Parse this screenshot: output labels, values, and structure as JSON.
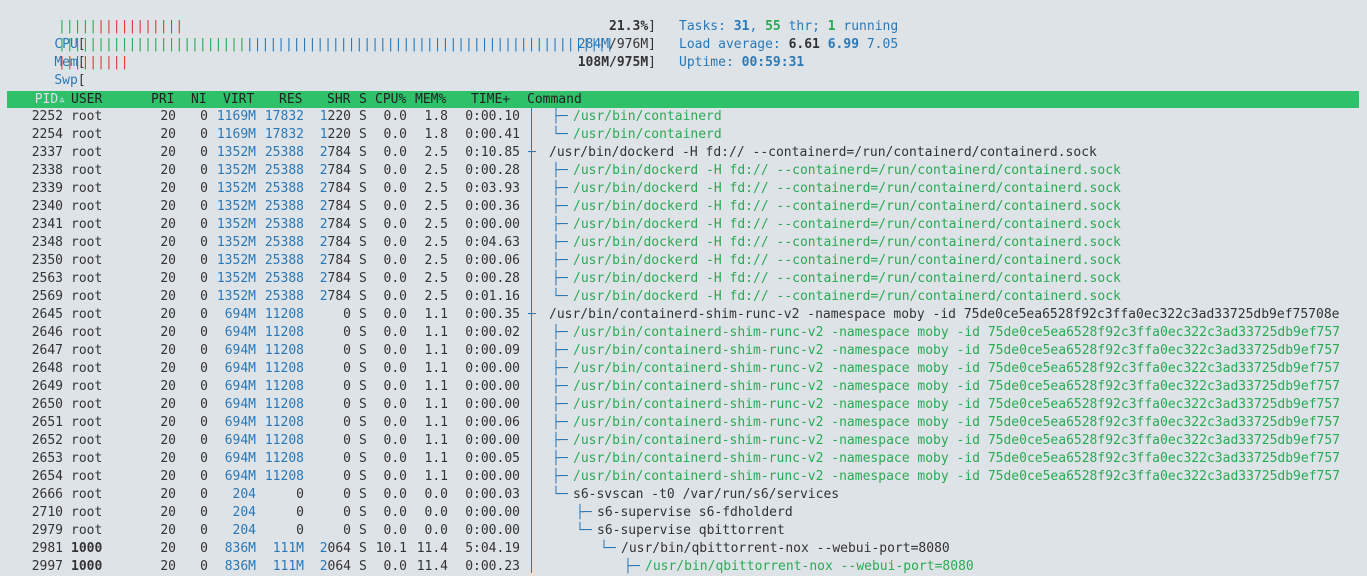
{
  "meters": {
    "cpu": {
      "label": "CPU",
      "green_bars": "|||||",
      "red_bars": "|||||||||||",
      "value": "21.3%"
    },
    "mem": {
      "label": "Mem",
      "green_bars": "||||||||||||||||||||||||",
      "blue_bars": "|||||||||||||||||||||||||||||||||||||||||||||||",
      "value_used": "284M",
      "value_total": "976M"
    },
    "swp": {
      "label": "Swp",
      "red_bars": "|||||||||",
      "value": "108M/975M"
    }
  },
  "info": {
    "tasks_label": "Tasks:",
    "tasks": "31",
    "threads": "55",
    "threads_suffix": "thr;",
    "running": "1",
    "running_suffix": "running",
    "load_label": "Load average:",
    "load1": "6.61",
    "load5": "6.99",
    "load15": "7.05",
    "uptime_label": "Uptime:",
    "uptime": "00:59:31"
  },
  "columns": {
    "pid": "PID",
    "sort_arrow": "▵",
    "user": "USER",
    "pri": "PRI",
    "ni": "NI",
    "virt": "VIRT",
    "res": "RES",
    "shr": "SHR",
    "s": "S",
    "cpu": "CPU%",
    "mem": "MEM%",
    "time": "TIME+",
    "command": "Command"
  },
  "processes": [
    {
      "pid": "2252",
      "user": "root",
      "pri": "20",
      "ni": "0",
      "virt": "1169M",
      "res_k": "17832",
      "res": "",
      "shr_k": "1",
      "shr": "220",
      "s": "S",
      "cpu": "0.0",
      "mem": "1.8",
      "time": "0:00.10",
      "tree": "├─ ",
      "indent": 2,
      "cmd": "/usr/bin/containerd",
      "thread": true
    },
    {
      "pid": "2254",
      "user": "root",
      "pri": "20",
      "ni": "0",
      "virt": "1169M",
      "res_k": "17832",
      "res": "",
      "shr_k": "1",
      "shr": "220",
      "s": "S",
      "cpu": "0.0",
      "mem": "1.8",
      "time": "0:00.41",
      "tree": "└─ ",
      "indent": 2,
      "cmd": "/usr/bin/containerd",
      "thread": true
    },
    {
      "pid": "2337",
      "user": "root",
      "pri": "20",
      "ni": "0",
      "virt": "1352M",
      "res_k": "25388",
      "res": "",
      "shr_k": "2",
      "shr": "784",
      "s": "S",
      "cpu": "0.0",
      "mem": "2.5",
      "time": "0:10.85",
      "tree": "├─ ",
      "indent": 1,
      "cmd": "/usr/bin/dockerd -H fd:// --containerd=/run/containerd/containerd.sock",
      "thread": false
    },
    {
      "pid": "2338",
      "user": "root",
      "pri": "20",
      "ni": "0",
      "virt": "1352M",
      "res_k": "25388",
      "res": "",
      "shr_k": "2",
      "shr": "784",
      "s": "S",
      "cpu": "0.0",
      "mem": "2.5",
      "time": "0:00.28",
      "tree": "├─ ",
      "indent": 2,
      "cmd": "/usr/bin/dockerd -H fd:// --containerd=/run/containerd/containerd.sock",
      "thread": true
    },
    {
      "pid": "2339",
      "user": "root",
      "pri": "20",
      "ni": "0",
      "virt": "1352M",
      "res_k": "25388",
      "res": "",
      "shr_k": "2",
      "shr": "784",
      "s": "S",
      "cpu": "0.0",
      "mem": "2.5",
      "time": "0:03.93",
      "tree": "├─ ",
      "indent": 2,
      "cmd": "/usr/bin/dockerd -H fd:// --containerd=/run/containerd/containerd.sock",
      "thread": true
    },
    {
      "pid": "2340",
      "user": "root",
      "pri": "20",
      "ni": "0",
      "virt": "1352M",
      "res_k": "25388",
      "res": "",
      "shr_k": "2",
      "shr": "784",
      "s": "S",
      "cpu": "0.0",
      "mem": "2.5",
      "time": "0:00.36",
      "tree": "├─ ",
      "indent": 2,
      "cmd": "/usr/bin/dockerd -H fd:// --containerd=/run/containerd/containerd.sock",
      "thread": true
    },
    {
      "pid": "2341",
      "user": "root",
      "pri": "20",
      "ni": "0",
      "virt": "1352M",
      "res_k": "25388",
      "res": "",
      "shr_k": "2",
      "shr": "784",
      "s": "S",
      "cpu": "0.0",
      "mem": "2.5",
      "time": "0:00.00",
      "tree": "├─ ",
      "indent": 2,
      "cmd": "/usr/bin/dockerd -H fd:// --containerd=/run/containerd/containerd.sock",
      "thread": true
    },
    {
      "pid": "2348",
      "user": "root",
      "pri": "20",
      "ni": "0",
      "virt": "1352M",
      "res_k": "25388",
      "res": "",
      "shr_k": "2",
      "shr": "784",
      "s": "S",
      "cpu": "0.0",
      "mem": "2.5",
      "time": "0:04.63",
      "tree": "├─ ",
      "indent": 2,
      "cmd": "/usr/bin/dockerd -H fd:// --containerd=/run/containerd/containerd.sock",
      "thread": true
    },
    {
      "pid": "2350",
      "user": "root",
      "pri": "20",
      "ni": "0",
      "virt": "1352M",
      "res_k": "25388",
      "res": "",
      "shr_k": "2",
      "shr": "784",
      "s": "S",
      "cpu": "0.0",
      "mem": "2.5",
      "time": "0:00.06",
      "tree": "├─ ",
      "indent": 2,
      "cmd": "/usr/bin/dockerd -H fd:// --containerd=/run/containerd/containerd.sock",
      "thread": true
    },
    {
      "pid": "2563",
      "user": "root",
      "pri": "20",
      "ni": "0",
      "virt": "1352M",
      "res_k": "25388",
      "res": "",
      "shr_k": "2",
      "shr": "784",
      "s": "S",
      "cpu": "0.0",
      "mem": "2.5",
      "time": "0:00.28",
      "tree": "├─ ",
      "indent": 2,
      "cmd": "/usr/bin/dockerd -H fd:// --containerd=/run/containerd/containerd.sock",
      "thread": true
    },
    {
      "pid": "2569",
      "user": "root",
      "pri": "20",
      "ni": "0",
      "virt": "1352M",
      "res_k": "25388",
      "res": "",
      "shr_k": "2",
      "shr": "784",
      "s": "S",
      "cpu": "0.0",
      "mem": "2.5",
      "time": "0:01.16",
      "tree": "└─ ",
      "indent": 2,
      "cmd": "/usr/bin/dockerd -H fd:// --containerd=/run/containerd/containerd.sock",
      "thread": true
    },
    {
      "pid": "2645",
      "user": "root",
      "pri": "20",
      "ni": "0",
      "virt": "694M",
      "res_k": "11208",
      "res": "",
      "shr_k": "",
      "shr": "0",
      "s": "S",
      "cpu": "0.0",
      "mem": "1.1",
      "time": "0:00.35",
      "tree": "├─ ",
      "indent": 1,
      "cmd": "/usr/bin/containerd-shim-runc-v2 -namespace moby -id 75de0ce5ea6528f92c3ffa0ec322c3ad33725db9ef75708e",
      "thread": false
    },
    {
      "pid": "2646",
      "user": "root",
      "pri": "20",
      "ni": "0",
      "virt": "694M",
      "res_k": "11208",
      "res": "",
      "shr_k": "",
      "shr": "0",
      "s": "S",
      "cpu": "0.0",
      "mem": "1.1",
      "time": "0:00.02",
      "tree": "├─ ",
      "indent": 2,
      "cmd": "/usr/bin/containerd-shim-runc-v2 -namespace moby -id 75de0ce5ea6528f92c3ffa0ec322c3ad33725db9ef757",
      "thread": true
    },
    {
      "pid": "2647",
      "user": "root",
      "pri": "20",
      "ni": "0",
      "virt": "694M",
      "res_k": "11208",
      "res": "",
      "shr_k": "",
      "shr": "0",
      "s": "S",
      "cpu": "0.0",
      "mem": "1.1",
      "time": "0:00.09",
      "tree": "├─ ",
      "indent": 2,
      "cmd": "/usr/bin/containerd-shim-runc-v2 -namespace moby -id 75de0ce5ea6528f92c3ffa0ec322c3ad33725db9ef757",
      "thread": true
    },
    {
      "pid": "2648",
      "user": "root",
      "pri": "20",
      "ni": "0",
      "virt": "694M",
      "res_k": "11208",
      "res": "",
      "shr_k": "",
      "shr": "0",
      "s": "S",
      "cpu": "0.0",
      "mem": "1.1",
      "time": "0:00.00",
      "tree": "├─ ",
      "indent": 2,
      "cmd": "/usr/bin/containerd-shim-runc-v2 -namespace moby -id 75de0ce5ea6528f92c3ffa0ec322c3ad33725db9ef757",
      "thread": true
    },
    {
      "pid": "2649",
      "user": "root",
      "pri": "20",
      "ni": "0",
      "virt": "694M",
      "res_k": "11208",
      "res": "",
      "shr_k": "",
      "shr": "0",
      "s": "S",
      "cpu": "0.0",
      "mem": "1.1",
      "time": "0:00.00",
      "tree": "├─ ",
      "indent": 2,
      "cmd": "/usr/bin/containerd-shim-runc-v2 -namespace moby -id 75de0ce5ea6528f92c3ffa0ec322c3ad33725db9ef757",
      "thread": true
    },
    {
      "pid": "2650",
      "user": "root",
      "pri": "20",
      "ni": "0",
      "virt": "694M",
      "res_k": "11208",
      "res": "",
      "shr_k": "",
      "shr": "0",
      "s": "S",
      "cpu": "0.0",
      "mem": "1.1",
      "time": "0:00.00",
      "tree": "├─ ",
      "indent": 2,
      "cmd": "/usr/bin/containerd-shim-runc-v2 -namespace moby -id 75de0ce5ea6528f92c3ffa0ec322c3ad33725db9ef757",
      "thread": true
    },
    {
      "pid": "2651",
      "user": "root",
      "pri": "20",
      "ni": "0",
      "virt": "694M",
      "res_k": "11208",
      "res": "",
      "shr_k": "",
      "shr": "0",
      "s": "S",
      "cpu": "0.0",
      "mem": "1.1",
      "time": "0:00.06",
      "tree": "├─ ",
      "indent": 2,
      "cmd": "/usr/bin/containerd-shim-runc-v2 -namespace moby -id 75de0ce5ea6528f92c3ffa0ec322c3ad33725db9ef757",
      "thread": true
    },
    {
      "pid": "2652",
      "user": "root",
      "pri": "20",
      "ni": "0",
      "virt": "694M",
      "res_k": "11208",
      "res": "",
      "shr_k": "",
      "shr": "0",
      "s": "S",
      "cpu": "0.0",
      "mem": "1.1",
      "time": "0:00.00",
      "tree": "├─ ",
      "indent": 2,
      "cmd": "/usr/bin/containerd-shim-runc-v2 -namespace moby -id 75de0ce5ea6528f92c3ffa0ec322c3ad33725db9ef757",
      "thread": true
    },
    {
      "pid": "2653",
      "user": "root",
      "pri": "20",
      "ni": "0",
      "virt": "694M",
      "res_k": "11208",
      "res": "",
      "shr_k": "",
      "shr": "0",
      "s": "S",
      "cpu": "0.0",
      "mem": "1.1",
      "time": "0:00.05",
      "tree": "├─ ",
      "indent": 2,
      "cmd": "/usr/bin/containerd-shim-runc-v2 -namespace moby -id 75de0ce5ea6528f92c3ffa0ec322c3ad33725db9ef757",
      "thread": true
    },
    {
      "pid": "2654",
      "user": "root",
      "pri": "20",
      "ni": "0",
      "virt": "694M",
      "res_k": "11208",
      "res": "",
      "shr_k": "",
      "shr": "0",
      "s": "S",
      "cpu": "0.0",
      "mem": "1.1",
      "time": "0:00.00",
      "tree": "├─ ",
      "indent": 2,
      "cmd": "/usr/bin/containerd-shim-runc-v2 -namespace moby -id 75de0ce5ea6528f92c3ffa0ec322c3ad33725db9ef757",
      "thread": true
    },
    {
      "pid": "2666",
      "user": "root",
      "pri": "20",
      "ni": "0",
      "virt": "204",
      "res_k": "",
      "res": "0",
      "shr_k": "",
      "shr": "0",
      "s": "S",
      "cpu": "0.0",
      "mem": "0.0",
      "time": "0:00.03",
      "tree": "└─ ",
      "indent": 2,
      "cmd": "s6-svscan -t0 /var/run/s6/services",
      "thread": false
    },
    {
      "pid": "2710",
      "user": "root",
      "pri": "20",
      "ni": "0",
      "virt": "204",
      "res_k": "",
      "res": "0",
      "shr_k": "",
      "shr": "0",
      "s": "S",
      "cpu": "0.0",
      "mem": "0.0",
      "time": "0:00.00",
      "tree": "├─ ",
      "indent": 3,
      "cmd": "s6-supervise s6-fdholderd",
      "thread": false
    },
    {
      "pid": "2979",
      "user": "root",
      "pri": "20",
      "ni": "0",
      "virt": "204",
      "res_k": "",
      "res": "0",
      "shr_k": "",
      "shr": "0",
      "s": "S",
      "cpu": "0.0",
      "mem": "0.0",
      "time": "0:00.00",
      "tree": "└─ ",
      "indent": 3,
      "cmd": "s6-supervise qbittorrent",
      "thread": false
    },
    {
      "pid": "2981",
      "user": "1000",
      "pri": "20",
      "ni": "0",
      "virt": "836M",
      "res_k": "111M",
      "res": "",
      "shr_k": "2",
      "shr": "064",
      "s": "S",
      "cpu": "10.1",
      "mem": "11.4",
      "time": "5:04.19",
      "tree": "└─ ",
      "indent": 4,
      "cmd": "/usr/bin/qbittorrent-nox --webui-port=8080",
      "thread": false
    },
    {
      "pid": "2997",
      "user": "1000",
      "pri": "20",
      "ni": "0",
      "virt": "836M",
      "res_k": "111M",
      "res": "",
      "shr_k": "2",
      "shr": "064",
      "s": "S",
      "cpu": "0.0",
      "mem": "11.4",
      "time": "0:00.23",
      "tree": "├─ ",
      "indent": 5,
      "cmd": "/usr/bin/qbittorrent-nox --webui-port=8080",
      "thread": true
    }
  ]
}
